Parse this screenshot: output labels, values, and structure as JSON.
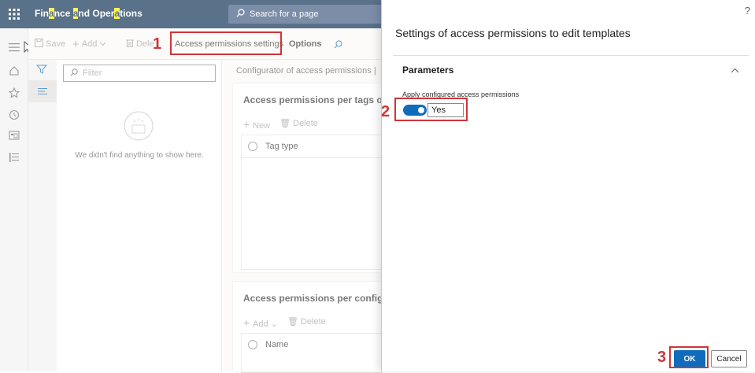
{
  "header": {
    "app_title_parts": [
      "Fin",
      "a",
      "nce ",
      "a",
      "nd Oper",
      "a",
      "tions"
    ],
    "search_placeholder": "Search for a page"
  },
  "toolbar": {
    "save": "Save",
    "add": "Add",
    "delete": "Dele",
    "access_permissions_settings": "Access permissions settings",
    "options": "Options"
  },
  "filter": {
    "placeholder": "Filter",
    "empty_message": "We didn't find anything to show here."
  },
  "main": {
    "breadcrumb": "Configurator of access permissions  |",
    "section1": {
      "title": "Access permissions per tags of c",
      "new": "New",
      "delete": "Delete",
      "column": "Tag type"
    },
    "section2": {
      "title": "Access permissions per configur",
      "add": "Add",
      "delete": "Delete",
      "column": "Name"
    }
  },
  "dialog": {
    "title": "Settings of access permissions to edit templates",
    "help": "?",
    "section": "Parameters",
    "field_label": "Apply configured access permissions",
    "toggle_value": "Yes",
    "toggle_on": true,
    "ok": "OK",
    "cancel": "Cancel"
  },
  "annotations": {
    "n1": "1",
    "n2": "2",
    "n3": "3"
  },
  "colors": {
    "topbar": "#00254b",
    "accent": "#0f6cbd",
    "highlight": "#d13438"
  }
}
